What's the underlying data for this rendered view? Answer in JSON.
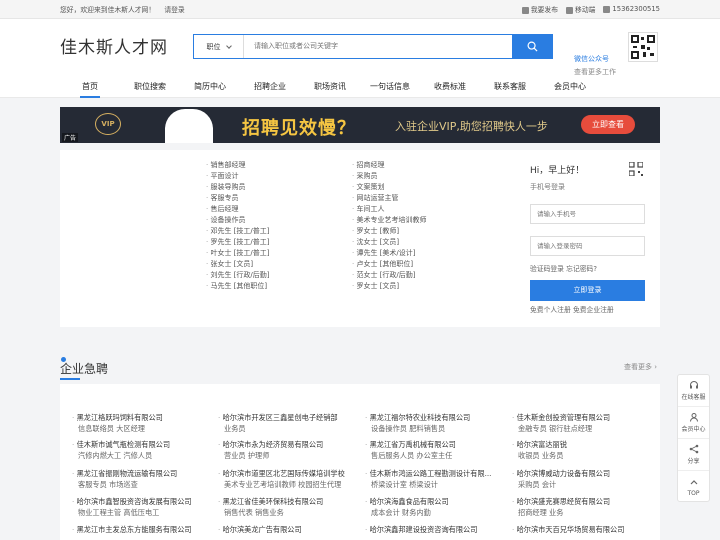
{
  "topbar": {
    "welcome": "您好，欢迎来到佳木斯人才网！",
    "login": "请登录",
    "publish": "我要发布",
    "mobile": "移动端",
    "phone": "15362300515"
  },
  "header": {
    "logo": "佳木斯人才网",
    "search_type": "职位",
    "search_placeholder": "请输入职位或者公司关键字",
    "wx_title": "微信公众号",
    "wx_sub": "查看更多工作"
  },
  "nav": [
    "首页",
    "职位搜索",
    "简历中心",
    "招聘企业",
    "职场资讯",
    "一句话信息",
    "收费标准",
    "联系客服",
    "会员中心"
  ],
  "banner": {
    "ad": "广告",
    "vip": "VIP",
    "headline": "招聘见效慢？",
    "tagline": "入驻企业VIP,助您招聘快人一步",
    "cta": "立即查看"
  },
  "posts_left": [
    "销售部经理",
    "平面设计",
    "服装导购员",
    "客服专员",
    "售后经理",
    "设备操作员",
    "邓先生 [技工/普工]",
    "罗先生 [技工/普工]",
    "叶女士 [技工/普工]",
    "张女士 [文员]",
    "刘先生 [行政/后勤]",
    "马先生 [其他职位]"
  ],
  "posts_right": [
    "招商经理",
    "采购员",
    "文案策划",
    "网站运营主管",
    "车间工人",
    "美术专业艺考培训教师",
    "罗女士 [教师]",
    "沈女士 [文员]",
    "谭先生 [美术/设计]",
    "卢女士 [其他职位]",
    "范女士 [行政/后勤]",
    "罗女士 [文员]"
  ],
  "login": {
    "greeting": "Hi，早上好！",
    "label": "手机号登录",
    "phone_placeholder": "请输入手机号",
    "code_placeholder": "请输入登录密码",
    "forgot": "验证码登录  忘记密码?",
    "button": "立即登录",
    "register": "免费个人注册  免费企业注册"
  },
  "section": {
    "title": "企业急聘",
    "more": "查看更多 ›"
  },
  "jobs": [
    {
      "company": "黑龙江格跃玛饲料有限公司",
      "positions": "信息联络员 大区经理"
    },
    {
      "company": "哈尔滨市开发区三鑫星创电子经销部",
      "positions": "业务员"
    },
    {
      "company": "黑龙江福尔特农业科技有限公司",
      "positions": "设备操作员 肥料销售员"
    },
    {
      "company": "佳木斯金创投资管理有限公司",
      "positions": "金融专员 银行驻点经理"
    },
    {
      "company": "佳木斯市诚气瓶检测有限公司",
      "positions": "汽修内燃大工 汽修人员"
    },
    {
      "company": "哈尔滨市永为经济贸易有限公司",
      "positions": "营业员 护理师"
    },
    {
      "company": "黑龙江省万禹机械有限公司",
      "positions": "售后服务人员 办公室主任"
    },
    {
      "company": "哈尔滨富达丽锐",
      "positions": "收银员 业务员"
    },
    {
      "company": "黑龙江省振刚物流运输有限公司",
      "positions": "客服专员 市场巡查"
    },
    {
      "company": "哈尔滨市道里区北艺国际传媒培训学校",
      "positions": "美术专业艺考培训教师 校园招生代理"
    },
    {
      "company": "佳木斯市鸿运公路工程勘测设计有限...",
      "positions": "桥梁设计室 桥梁设计"
    },
    {
      "company": "哈尔滨博威动力设备有限公司",
      "positions": "采购员 会计"
    },
    {
      "company": "哈尔滨市鑫智股资咨询发展有限公司",
      "positions": "物业工程主管 高低压电工"
    },
    {
      "company": "黑龙江省佳美环保科技有限公司",
      "positions": "销售代表 销售业务"
    },
    {
      "company": "哈尔滨海鑫食品有限公司",
      "positions": "成本会计 财务内勤"
    },
    {
      "company": "哈尔滨盛克赛思经贸有限公司",
      "positions": "招商经理 业务"
    },
    {
      "company": "黑龙江市主发总东方能服务有限公司",
      "positions": ""
    },
    {
      "company": "哈尔滨美龙广告有限公司",
      "positions": ""
    },
    {
      "company": "哈尔滨鑫邦建设投资咨询有限公司",
      "positions": ""
    },
    {
      "company": "哈尔滨市天百兄华场贸易有限公司",
      "positions": ""
    }
  ],
  "float": [
    "在线客服",
    "会员中心",
    "分享",
    "TOP"
  ],
  "colors": {
    "accent": "#2a7de1",
    "cta": "#e74c3c"
  }
}
